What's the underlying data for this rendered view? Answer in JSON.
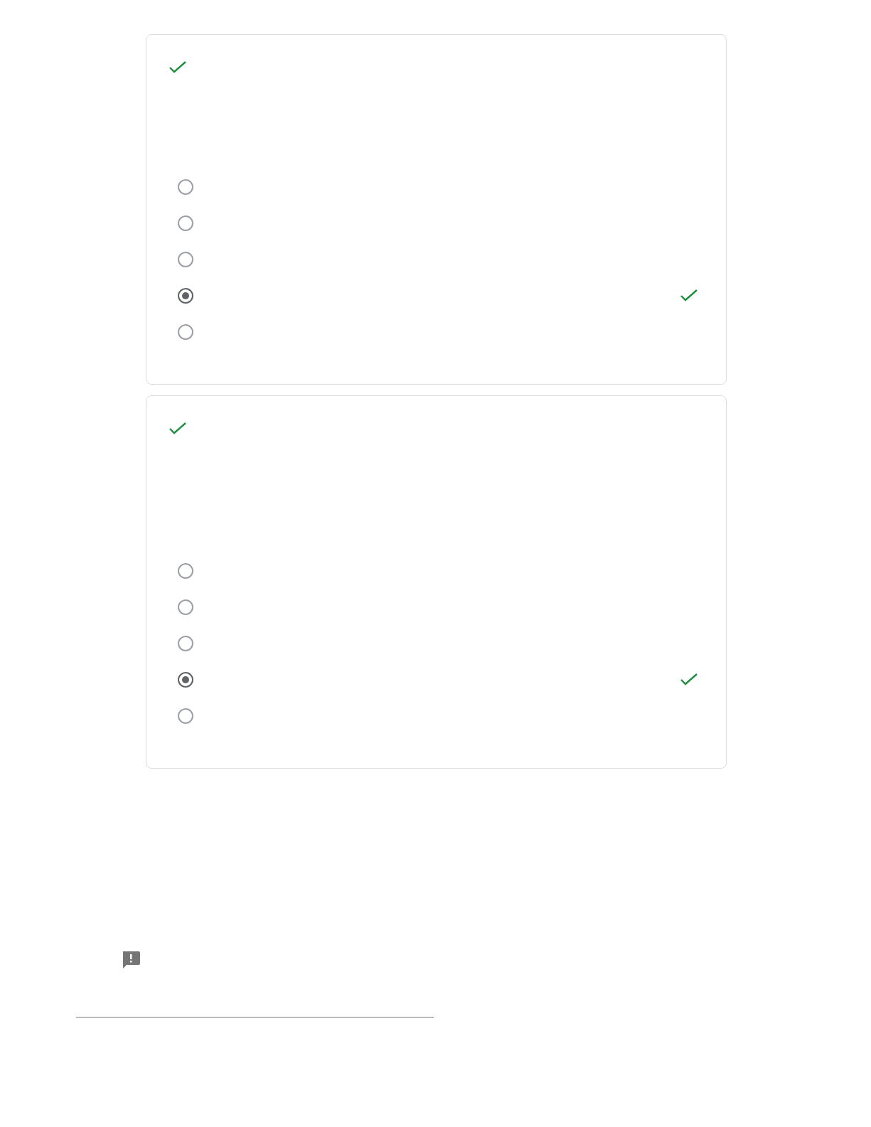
{
  "questions": [
    {
      "correct": true,
      "options": [
        {
          "selected": false,
          "correct": false
        },
        {
          "selected": false,
          "correct": false
        },
        {
          "selected": false,
          "correct": false
        },
        {
          "selected": true,
          "correct": true
        },
        {
          "selected": false,
          "correct": false
        }
      ]
    },
    {
      "correct": true,
      "options": [
        {
          "selected": false,
          "correct": false
        },
        {
          "selected": false,
          "correct": false
        },
        {
          "selected": false,
          "correct": false
        },
        {
          "selected": true,
          "correct": true
        },
        {
          "selected": false,
          "correct": false
        }
      ]
    }
  ]
}
